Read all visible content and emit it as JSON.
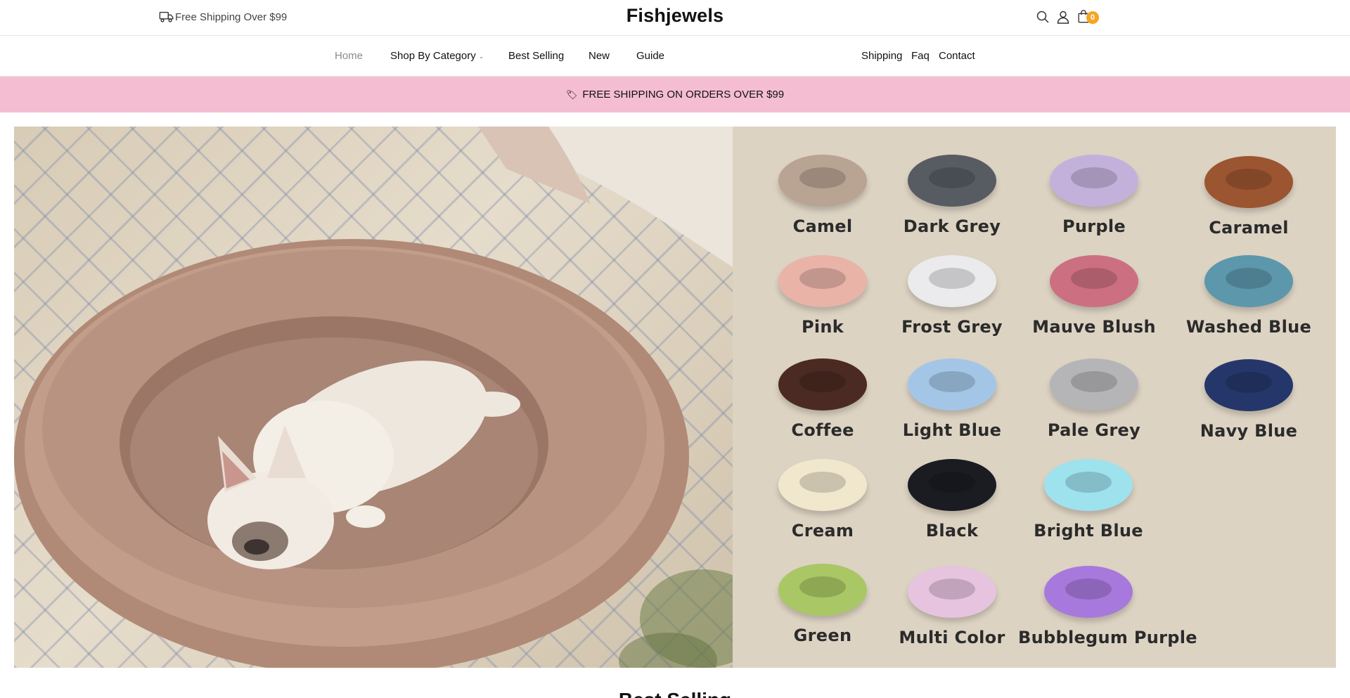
{
  "header": {
    "shipping_note": "Free Shipping Over $99",
    "logo": "Fishjewels",
    "cart_count": "0"
  },
  "nav": {
    "left": [
      {
        "label": "Home"
      },
      {
        "label": "Shop By Category"
      },
      {
        "label": "Best Selling"
      },
      {
        "label": "New"
      },
      {
        "label": "Guide"
      }
    ],
    "right": [
      {
        "label": "Shipping"
      },
      {
        "label": "Faq"
      },
      {
        "label": "Contact"
      }
    ]
  },
  "promo": {
    "icon": "tag-icon",
    "text": "FREE SHIPPING ON ORDERS OVER $99"
  },
  "hero": {
    "swatches": [
      {
        "name": "Camel",
        "color": "#b9a392"
      },
      {
        "name": "Dark Grey",
        "color": "#575c63"
      },
      {
        "name": "Purple",
        "color": "#c3b1dc"
      },
      {
        "name": "Caramel",
        "color": "#9b5530"
      },
      {
        "name": "Pink",
        "color": "#e9b3a8"
      },
      {
        "name": "Frost Grey",
        "color": "#ebebed"
      },
      {
        "name": "Mauve Blush",
        "color": "#cc6f81"
      },
      {
        "name": "Washed Blue",
        "color": "#5c97ab"
      },
      {
        "name": "Coffee",
        "color": "#4a2a22"
      },
      {
        "name": "Light Blue",
        "color": "#a4c6e6"
      },
      {
        "name": "Pale Grey",
        "color": "#b5b5b8"
      },
      {
        "name": "Navy Blue",
        "color": "#25376a"
      },
      {
        "name": "Cream",
        "color": "#f1e7cd"
      },
      {
        "name": "Black",
        "color": "#1a1c22"
      },
      {
        "name": "Bright Blue",
        "color": "#9ee2ee"
      },
      {
        "name": "Green",
        "color": "#a9c764"
      },
      {
        "name": "Multi Color",
        "color": "#e6c4e0"
      },
      {
        "name": "Bubblegum Purple",
        "color": "#a879dc"
      }
    ]
  },
  "section": {
    "title": "Best Selling"
  },
  "colors": {
    "promo_bg": "#f5bdd2",
    "badge": "#f5a623",
    "swatch_panel": "#ddd3c3"
  }
}
